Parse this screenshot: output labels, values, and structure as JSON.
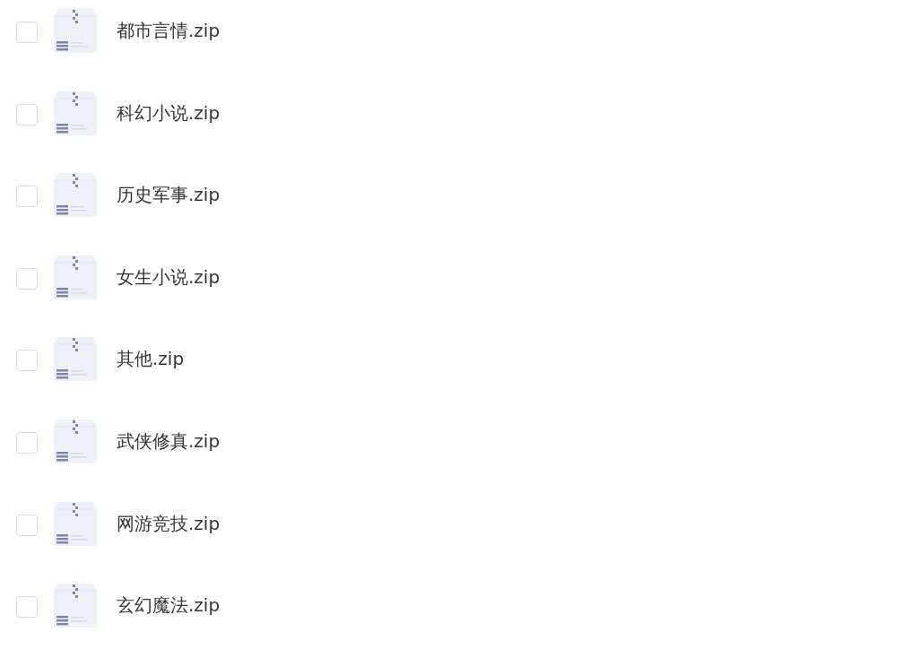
{
  "files": [
    {
      "name": "都市言情.zip",
      "checked": false
    },
    {
      "name": "科幻小说.zip",
      "checked": false
    },
    {
      "name": "历史军事.zip",
      "checked": false
    },
    {
      "name": "女生小说.zip",
      "checked": false
    },
    {
      "name": "其他.zip",
      "checked": false
    },
    {
      "name": "武侠修真.zip",
      "checked": false
    },
    {
      "name": "网游竞技.zip",
      "checked": false
    },
    {
      "name": "玄幻魔法.zip",
      "checked": false
    }
  ]
}
